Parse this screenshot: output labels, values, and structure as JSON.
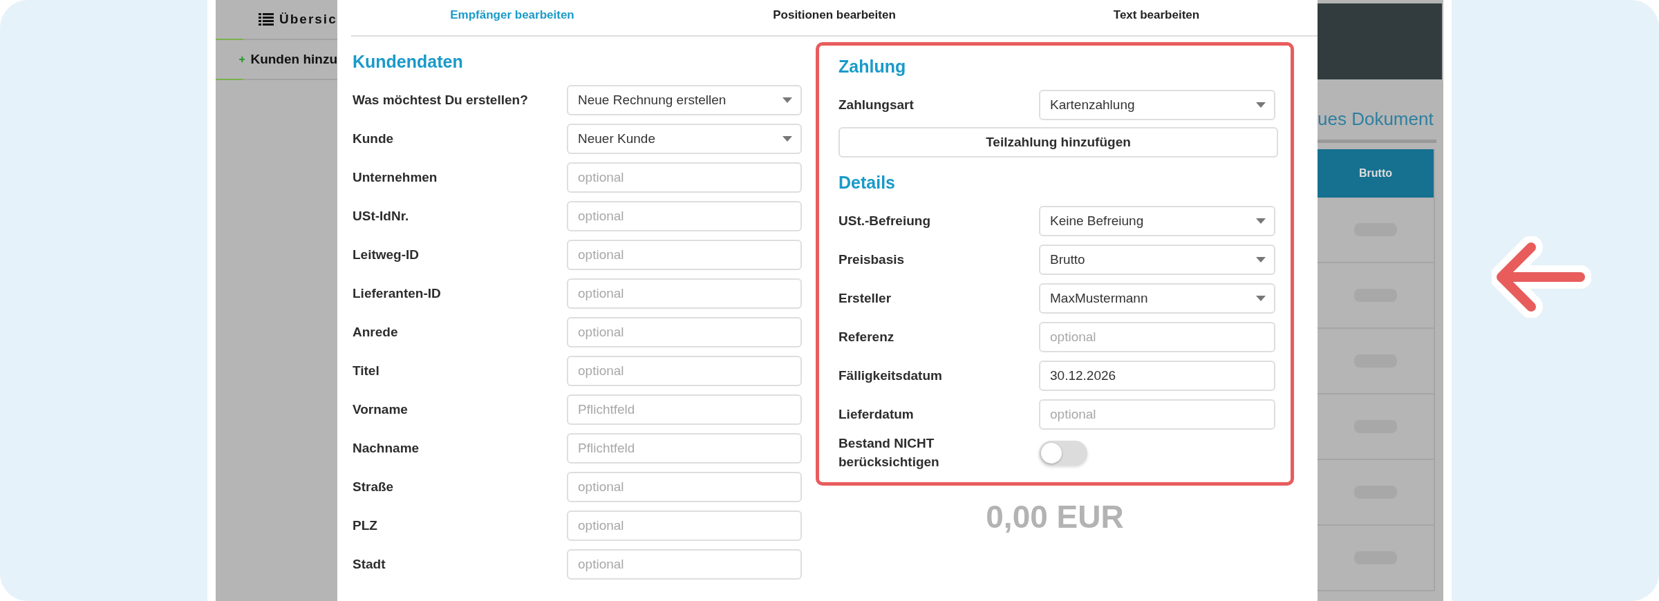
{
  "sidebar": [
    {
      "kind": "list",
      "label": "Übersic"
    },
    {
      "kind": "add",
      "label": "Kunden hinzu"
    }
  ],
  "right_panel": {
    "link": "ues Dokument",
    "table": {
      "columns": [
        "Brutto"
      ],
      "rows": [
        {
          "kind": "placeholder"
        },
        {
          "kind": "placeholder"
        },
        {
          "kind": "placeholder"
        },
        {
          "kind": "placeholder"
        },
        {
          "kind": "placeholder"
        },
        {
          "kind": "placeholder"
        }
      ]
    }
  },
  "modal": {
    "tabs": [
      {
        "label": "Empfänger bearbeiten",
        "selected": true
      },
      {
        "label": "Positionen bearbeiten",
        "selected": false
      },
      {
        "label": "Text bearbeiten",
        "selected": false
      }
    ],
    "customer": {
      "title": "Kundendaten",
      "fields": [
        {
          "label": "Was möchtest Du erstellen?",
          "kind": "select",
          "value": "Neue Rechnung erstellen"
        },
        {
          "label": "Kunde",
          "kind": "select",
          "value": "Neuer Kunde"
        },
        {
          "label": "Unternehmen",
          "kind": "input",
          "placeholder": "optional"
        },
        {
          "label": "USt-IdNr.",
          "kind": "input",
          "placeholder": "optional"
        },
        {
          "label": "Leitweg-ID",
          "kind": "input",
          "placeholder": "optional"
        },
        {
          "label": "Lieferanten-ID",
          "kind": "input",
          "placeholder": "optional"
        },
        {
          "label": "Anrede",
          "kind": "input",
          "placeholder": "optional"
        },
        {
          "label": "Titel",
          "kind": "input",
          "placeholder": "optional"
        },
        {
          "label": "Vorname",
          "kind": "input",
          "placeholder": "Pflichtfeld"
        },
        {
          "label": "Nachname",
          "kind": "input",
          "placeholder": "Pflichtfeld"
        },
        {
          "label": "Straße",
          "kind": "input",
          "placeholder": "optional"
        },
        {
          "label": "PLZ",
          "kind": "input",
          "placeholder": "optional"
        },
        {
          "label": "Stadt",
          "kind": "input",
          "placeholder": "optional"
        }
      ]
    },
    "payment": {
      "title": "Zahlung",
      "fields": [
        {
          "label": "Zahlungsart",
          "kind": "select",
          "value": "Kartenzahlung"
        },
        {
          "label": "Teilzahlung hinzufügen",
          "kind": "button"
        }
      ]
    },
    "details": {
      "title": "Details",
      "fields": [
        {
          "label": "USt.-Befreiung",
          "kind": "select",
          "value": "Keine Befreiung"
        },
        {
          "label": "Preisbasis",
          "kind": "select",
          "value": "Brutto"
        },
        {
          "label": "Ersteller",
          "kind": "select",
          "value": "MaxMustermann"
        },
        {
          "label": "Referenz",
          "kind": "input",
          "placeholder": "optional"
        },
        {
          "label": "Fälligkeitsdatum",
          "kind": "input",
          "value": "30.12.2026"
        },
        {
          "label": "Lieferdatum",
          "kind": "input",
          "placeholder": "optional"
        },
        {
          "label": "Bestand NICHT berücksichtigen",
          "kind": "toggle",
          "on": false
        }
      ]
    },
    "total": "0,00 EUR"
  }
}
